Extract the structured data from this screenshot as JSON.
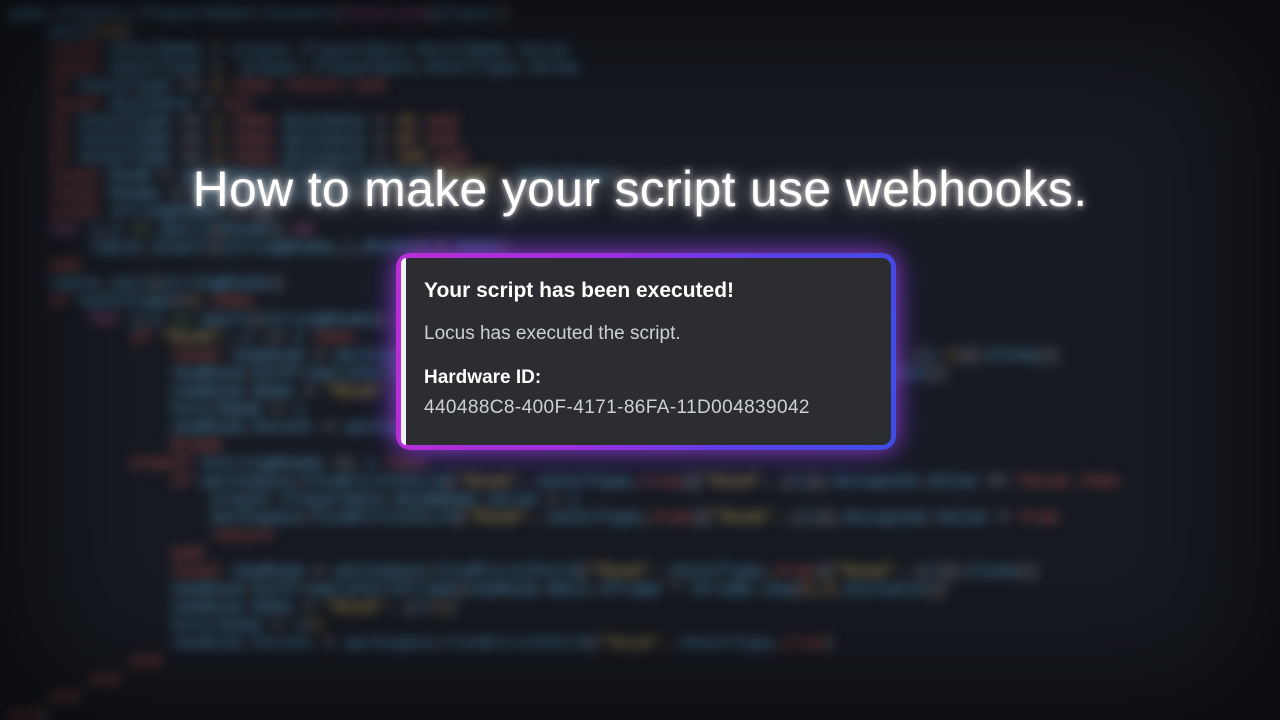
{
  "title": "How to make your script use webhooks.",
  "embed": {
    "heading": "Your script has been executed!",
    "description": "Locus has executed the script.",
    "field_name": "Hardware ID:",
    "field_value": "440488C8-400F-4171-86FA-11D004839042"
  }
}
